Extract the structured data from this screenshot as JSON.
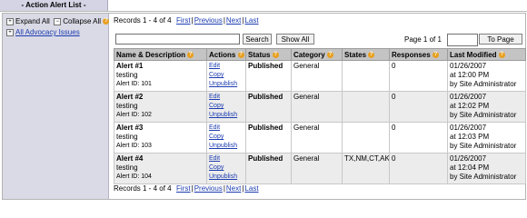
{
  "tab": {
    "title": "- Action Alert List -"
  },
  "sidebar": {
    "expand_all": "Expand All",
    "collapse_all": "Collapse All",
    "tree_root": "All Advocacy Issues"
  },
  "records": {
    "text": "Records 1 - 4 of 4",
    "first": "First",
    "previous": "Previous",
    "next": "Next",
    "last": "Last"
  },
  "search": {
    "value": "",
    "button": "Search",
    "show_all": "Show All"
  },
  "paging": {
    "label": "Page 1 of 1",
    "value": "",
    "button": "To Page"
  },
  "table": {
    "headers": [
      "Name & Description",
      "Actions",
      "Status",
      "Category",
      "States",
      "Responses",
      "Last Modified"
    ],
    "actions": [
      "Edit",
      "Copy",
      "Unpublish"
    ],
    "rows": [
      {
        "name": "Alert #1",
        "desc": "testing",
        "id": "Alert ID: 101",
        "status": "Published",
        "category": "General",
        "states": "",
        "responses": "0",
        "date": "01/26/2007",
        "time": "at 12:00 PM",
        "by": "by Site Administrator"
      },
      {
        "name": "Alert #2",
        "desc": "testing",
        "id": "Alert ID: 102",
        "status": "Published",
        "category": "General",
        "states": "",
        "responses": "0",
        "date": "01/26/2007",
        "time": "at 12:02 PM",
        "by": "by Site Administrator"
      },
      {
        "name": "Alert #3",
        "desc": "testing",
        "id": "Alert ID: 103",
        "status": "Published",
        "category": "General",
        "states": "",
        "responses": "0",
        "date": "01/26/2007",
        "time": "at 12:03 PM",
        "by": "by Site Administrator"
      },
      {
        "name": "Alert #4",
        "desc": "testing",
        "id": "Alert ID: 104",
        "status": "Published",
        "category": "General",
        "states": "TX,NM,CT,AK",
        "responses": "0",
        "date": "01/26/2007",
        "time": "at 12:04 PM",
        "by": "by Site Administrator"
      }
    ]
  }
}
